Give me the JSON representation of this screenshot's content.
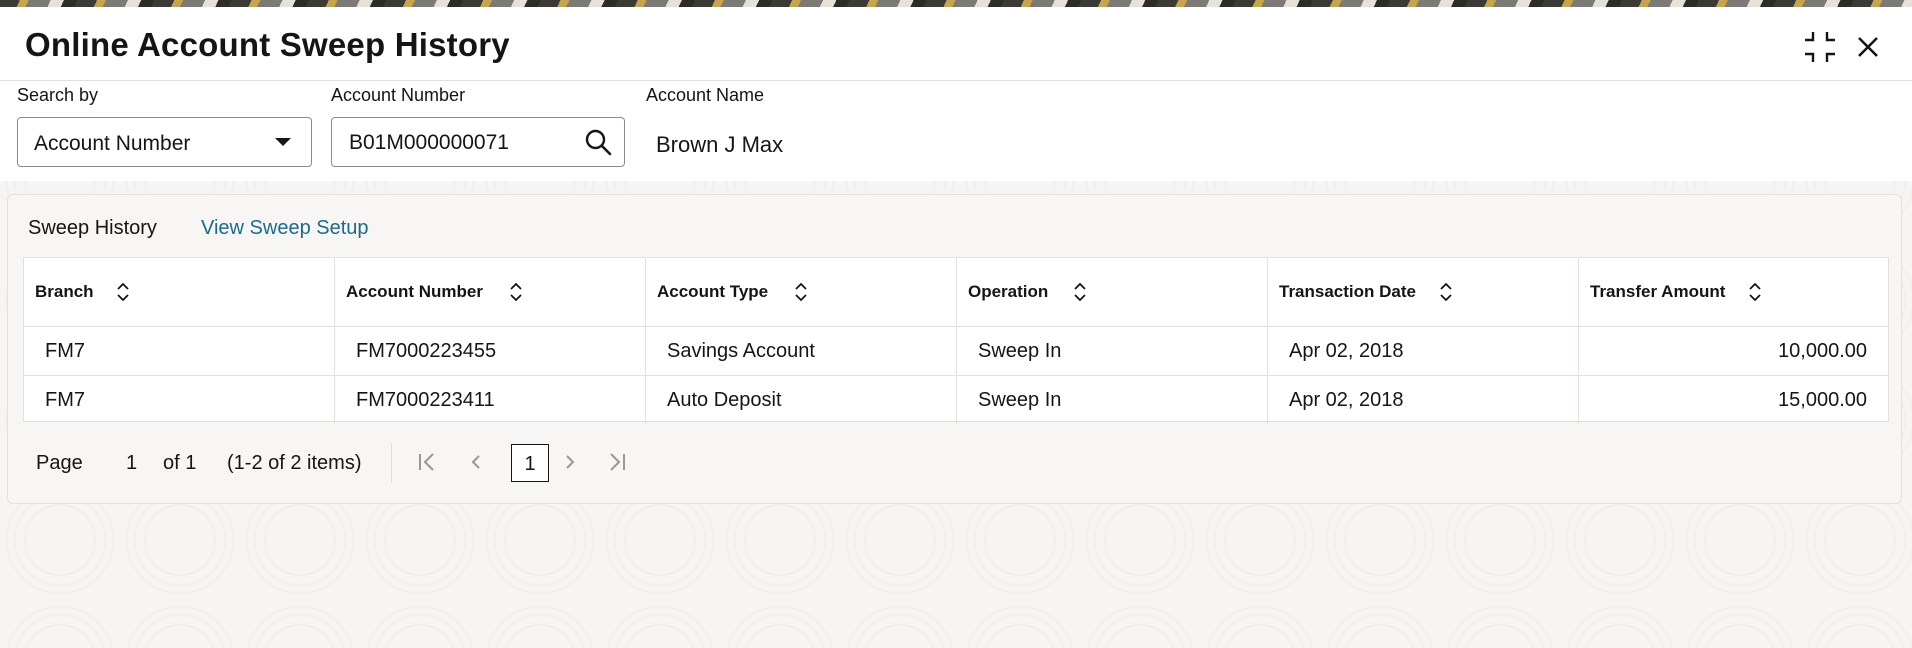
{
  "header": {
    "title": "Online Account Sweep History"
  },
  "icons": {
    "minimize": "minimize-icon",
    "close": "close-icon",
    "search": "search-icon",
    "sort": "sort-icon"
  },
  "filters": {
    "search_by_label": "Search by",
    "search_by_value": "Account Number",
    "account_number_label": "Account Number",
    "account_number_value": "B01M000000071",
    "account_name_label": "Account Name",
    "account_name_value": "Brown J Max"
  },
  "tabs": [
    {
      "label": "Sweep History"
    },
    {
      "label": "View Sweep Setup"
    }
  ],
  "table": {
    "columns": [
      "Branch",
      "Account Number",
      "Account Type",
      "Operation",
      "Transaction Date",
      "Transfer Amount"
    ],
    "rows": [
      [
        "FM7",
        "FM7000223455",
        "Savings Account",
        "Sweep In",
        "Apr 02, 2018",
        "10,000.00"
      ],
      [
        "FM7",
        "FM7000223411",
        "Auto Deposit",
        "Sweep In",
        "Apr 02, 2018",
        "15,000.00"
      ]
    ]
  },
  "pagination": {
    "page_label": "Page",
    "page_number": "1",
    "of_label": "of 1",
    "items_label": "(1-2 of 2 items)",
    "current_page": "1"
  },
  "colors": {
    "link": "#1c6a8a",
    "border": "#e4e1dc",
    "text": "#161513"
  }
}
